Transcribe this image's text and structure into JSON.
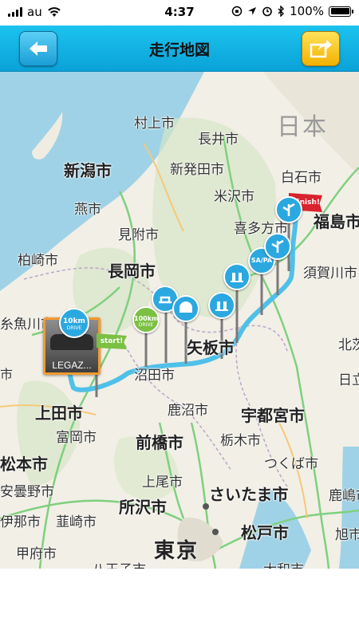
{
  "status": {
    "carrier": "au",
    "time": "4:37",
    "battery": "100%"
  },
  "header": {
    "title": "走行地図",
    "back_icon": "arrow-left-icon",
    "share_icon": "share-export-icon",
    "back_color": "#1a9ed6",
    "share_color": "#f2b200"
  },
  "map": {
    "country_label": "日本",
    "cities": {
      "murakami": "村上市",
      "nagai": "長井市",
      "niigata": "新潟市",
      "shibata": "新発田市",
      "shiroishi": "白石市",
      "yonezawa": "米沢市",
      "tsubame": "燕市",
      "fukushima": "福島市",
      "kitakata": "喜多方市",
      "mitsuke": "見附市",
      "kashiwazaki": "柏崎市",
      "nagaoka": "長岡市",
      "sukagawa": "須賀川市",
      "itoigawa": "糸魚川市",
      "yaita": "矢板市",
      "numata": "沼田市",
      "ueda": "上田市",
      "kanuma": "鹿沼市",
      "utsunomiya": "宇都宮市",
      "tomioka": "富岡市",
      "maebashi": "前橋市",
      "tochigi": "栃木市",
      "matsumoto": "松本市",
      "tsukuba": "つくば市",
      "azumino": "安曇野市",
      "ageo": "上尾市",
      "saitama": "さいたま市",
      "kashima": "鹿嶋市",
      "tokorozawa": "所沢市",
      "ina": "伊那市",
      "nirasaki": "韮崎市",
      "matsudo": "松戸市",
      "asahi": "旭市",
      "kofu": "甲府市",
      "tokyo": "東京",
      "hachioji": "八王子市",
      "kitaibaraki": "北茨城市",
      "hitachi": "日立市",
      "edge_left": "市",
      "edge_bottom": "大和市"
    },
    "route_color": "#4fc0e8",
    "start_marker": {
      "photo_label": "LEGAZ...",
      "flag_label": "start!",
      "distance_badge": "10km",
      "distance_sub": "DRIVE"
    },
    "milestone": {
      "distance": "100km",
      "sub": "DRIVE"
    },
    "finish_marker": {
      "flag_label": "finish!"
    },
    "pins": [
      {
        "icon": "highway-interchange-icon",
        "label": ""
      },
      {
        "icon": "tunnel-icon",
        "label": ""
      },
      {
        "icon": "toll-gate-icon",
        "label": ""
      },
      {
        "icon": "toll-gate-icon",
        "label": ""
      },
      {
        "icon": "service-area-icon",
        "label": "SA/PA"
      },
      {
        "icon": "junction-icon",
        "label": ""
      },
      {
        "icon": "junction-icon",
        "label": ""
      }
    ]
  }
}
